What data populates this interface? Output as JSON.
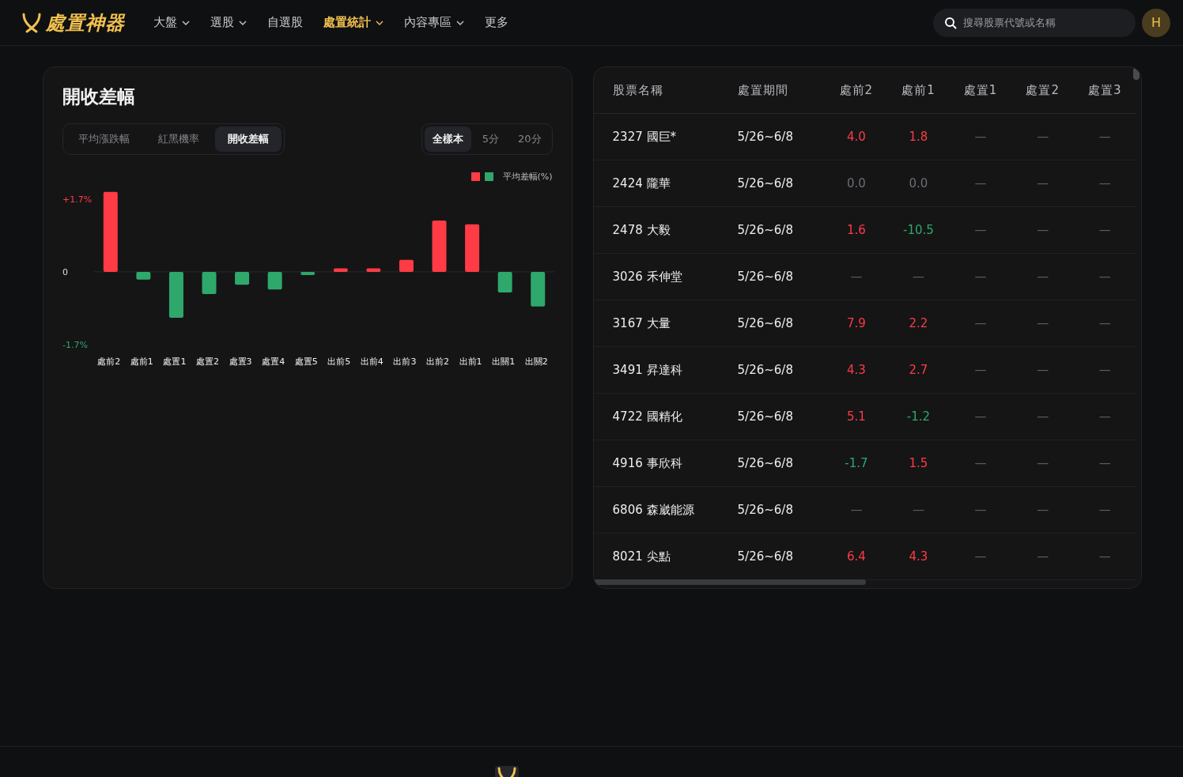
{
  "header": {
    "logo": "處置神器",
    "nav": [
      {
        "label": "大盤",
        "dropdown": true,
        "selected": false
      },
      {
        "label": "選股",
        "dropdown": true,
        "selected": false
      },
      {
        "label": "自選股",
        "dropdown": false,
        "selected": false
      },
      {
        "label": "處置統計",
        "dropdown": true,
        "selected": true
      },
      {
        "label": "內容專區",
        "dropdown": true,
        "selected": false
      },
      {
        "label": "更多",
        "dropdown": false,
        "selected": false
      }
    ],
    "search": {
      "placeholder": "搜尋股票代號或名稱"
    },
    "avatar": "H"
  },
  "chart_panel": {
    "title": "開收差幅",
    "metric_tabs": [
      {
        "label": "平均漲跌幅",
        "selected": false
      },
      {
        "label": "紅黑機率",
        "selected": false
      },
      {
        "label": "開收差幅",
        "selected": true
      }
    ],
    "sample_tabs": [
      {
        "label": "全樣本",
        "selected": true
      },
      {
        "label": "5分",
        "selected": false
      },
      {
        "label": "20分",
        "selected": false
      }
    ],
    "chart_data": {
      "type": "bar",
      "categories": [
        "處前2",
        "處前1",
        "處置1",
        "處置2",
        "處置3",
        "處置4",
        "處置5",
        "出前5",
        "出前4",
        "出前3",
        "出前2",
        "出前1",
        "出關1",
        "出關2"
      ],
      "series": [
        {
          "name": "平均差幅(%)",
          "color": "#ff3b45",
          "values": [
            1.87,
            null,
            null,
            null,
            null,
            null,
            null,
            0.08,
            0.08,
            0.28,
            1.2,
            1.11,
            null,
            null
          ]
        },
        {
          "color": "#2ea86b",
          "values": [
            null,
            -0.18,
            -1.07,
            -0.52,
            -0.3,
            -0.41,
            -0.07,
            null,
            null,
            null,
            null,
            null,
            -0.48,
            -0.81
          ]
        }
      ],
      "ylim": [
        -1.7,
        1.9
      ],
      "yticks": [
        {
          "value": 1.7,
          "label": "+1.7%"
        },
        {
          "value": 0,
          "label": "0"
        },
        {
          "value": -1.7,
          "label": "-1.7%"
        }
      ]
    }
  },
  "table": {
    "columns": [
      "股票名稱",
      "處置期間",
      "處前2",
      "處前1",
      "處置1",
      "處置2",
      "處置3"
    ],
    "rows": [
      {
        "cells": [
          {
            "text": "2327 國巨*",
            "color": "#eeeeee"
          },
          {
            "text": "5/26~6/8",
            "color": "#eeeeee"
          },
          {
            "text": "4.0",
            "color": "#ff3b45"
          },
          {
            "text": "1.8",
            "color": "#ff3b45"
          },
          {
            "text": "—",
            "color": "#5a5d62"
          },
          {
            "text": "—",
            "color": "#5a5d62"
          },
          {
            "text": "—",
            "color": "#5a5d62"
          }
        ]
      },
      {
        "cells": [
          {
            "text": "2424 隴華",
            "color": "#eeeeee"
          },
          {
            "text": "5/26~6/8",
            "color": "#eeeeee"
          },
          {
            "text": "0.0",
            "color": "#6b6e74"
          },
          {
            "text": "0.0",
            "color": "#6b6e74"
          },
          {
            "text": "—",
            "color": "#5a5d62"
          },
          {
            "text": "—",
            "color": "#5a5d62"
          },
          {
            "text": "—",
            "color": "#5a5d62"
          }
        ]
      },
      {
        "cells": [
          {
            "text": "2478 大毅",
            "color": "#eeeeee"
          },
          {
            "text": "5/26~6/8",
            "color": "#eeeeee"
          },
          {
            "text": "1.6",
            "color": "#ff3b45"
          },
          {
            "text": "-10.5",
            "color": "#2ea86b"
          },
          {
            "text": "—",
            "color": "#5a5d62"
          },
          {
            "text": "—",
            "color": "#5a5d62"
          },
          {
            "text": "—",
            "color": "#5a5d62"
          }
        ]
      },
      {
        "cells": [
          {
            "text": "3026 禾伸堂",
            "color": "#eeeeee"
          },
          {
            "text": "5/26~6/8",
            "color": "#eeeeee"
          },
          {
            "text": "—",
            "color": "#5a5d62"
          },
          {
            "text": "—",
            "color": "#5a5d62"
          },
          {
            "text": "—",
            "color": "#5a5d62"
          },
          {
            "text": "—",
            "color": "#5a5d62"
          },
          {
            "text": "—",
            "color": "#5a5d62"
          }
        ]
      },
      {
        "cells": [
          {
            "text": "3167 大量",
            "color": "#eeeeee"
          },
          {
            "text": "5/26~6/8",
            "color": "#eeeeee"
          },
          {
            "text": "7.9",
            "color": "#ff3b45"
          },
          {
            "text": "2.2",
            "color": "#ff3b45"
          },
          {
            "text": "—",
            "color": "#5a5d62"
          },
          {
            "text": "—",
            "color": "#5a5d62"
          },
          {
            "text": "—",
            "color": "#5a5d62"
          }
        ]
      },
      {
        "cells": [
          {
            "text": "3491 昇達科",
            "color": "#eeeeee"
          },
          {
            "text": "5/26~6/8",
            "color": "#eeeeee"
          },
          {
            "text": "4.3",
            "color": "#ff3b45"
          },
          {
            "text": "2.7",
            "color": "#ff3b45"
          },
          {
            "text": "—",
            "color": "#5a5d62"
          },
          {
            "text": "—",
            "color": "#5a5d62"
          },
          {
            "text": "—",
            "color": "#5a5d62"
          }
        ]
      },
      {
        "cells": [
          {
            "text": "4722 國精化",
            "color": "#eeeeee"
          },
          {
            "text": "5/26~6/8",
            "color": "#eeeeee"
          },
          {
            "text": "5.1",
            "color": "#ff3b45"
          },
          {
            "text": "-1.2",
            "color": "#2ea86b"
          },
          {
            "text": "—",
            "color": "#5a5d62"
          },
          {
            "text": "—",
            "color": "#5a5d62"
          },
          {
            "text": "—",
            "color": "#5a5d62"
          }
        ]
      },
      {
        "cells": [
          {
            "text": "4916 事欣科",
            "color": "#eeeeee"
          },
          {
            "text": "5/26~6/8",
            "color": "#eeeeee"
          },
          {
            "text": "-1.7",
            "color": "#2ea86b"
          },
          {
            "text": "1.5",
            "color": "#ff3b45"
          },
          {
            "text": "—",
            "color": "#5a5d62"
          },
          {
            "text": "—",
            "color": "#5a5d62"
          },
          {
            "text": "—",
            "color": "#5a5d62"
          }
        ]
      },
      {
        "cells": [
          {
            "text": "6806 森崴能源",
            "color": "#eeeeee"
          },
          {
            "text": "5/26~6/8",
            "color": "#eeeeee"
          },
          {
            "text": "—",
            "color": "#5a5d62"
          },
          {
            "text": "—",
            "color": "#5a5d62"
          },
          {
            "text": "—",
            "color": "#5a5d62"
          },
          {
            "text": "—",
            "color": "#5a5d62"
          },
          {
            "text": "—",
            "color": "#5a5d62"
          }
        ]
      },
      {
        "cells": [
          {
            "text": "8021 尖點",
            "color": "#eeeeee"
          },
          {
            "text": "5/26~6/8",
            "color": "#eeeeee"
          },
          {
            "text": "6.4",
            "color": "#ff3b45"
          },
          {
            "text": "4.3",
            "color": "#ff3b45"
          },
          {
            "text": "—",
            "color": "#5a5d62"
          },
          {
            "text": "—",
            "color": "#5a5d62"
          },
          {
            "text": "—",
            "color": "#5a5d62"
          }
        ]
      }
    ]
  }
}
